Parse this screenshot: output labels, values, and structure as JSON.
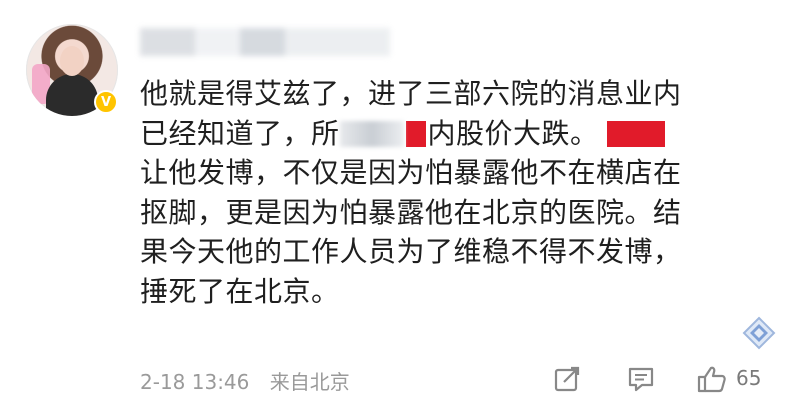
{
  "comment": {
    "lines": [
      "他就是得艾兹了，进了三部六院的消息业内",
      "已经知道了，所",
      "内股价大跌。",
      "让他发博，不仅是因为怕暴露他不在横店在",
      "抠脚，更是因为怕暴露他在北京的医院。结",
      "果今天他的工作人员为了维稳不得不发博，",
      "捶死了在北京。"
    ]
  },
  "footer": {
    "time": "2-18 13:46",
    "location": "来自北京"
  },
  "actions": {
    "like_count": "65"
  },
  "icons": {
    "share": "share-icon",
    "comment": "comment-icon",
    "like": "thumbs-up-icon",
    "badge": "verified-badge-icon",
    "diamond": "diamond-icon"
  },
  "colors": {
    "censor": "#e11b2a",
    "badge": "#ffc400",
    "meta": "#9a9a9a"
  }
}
